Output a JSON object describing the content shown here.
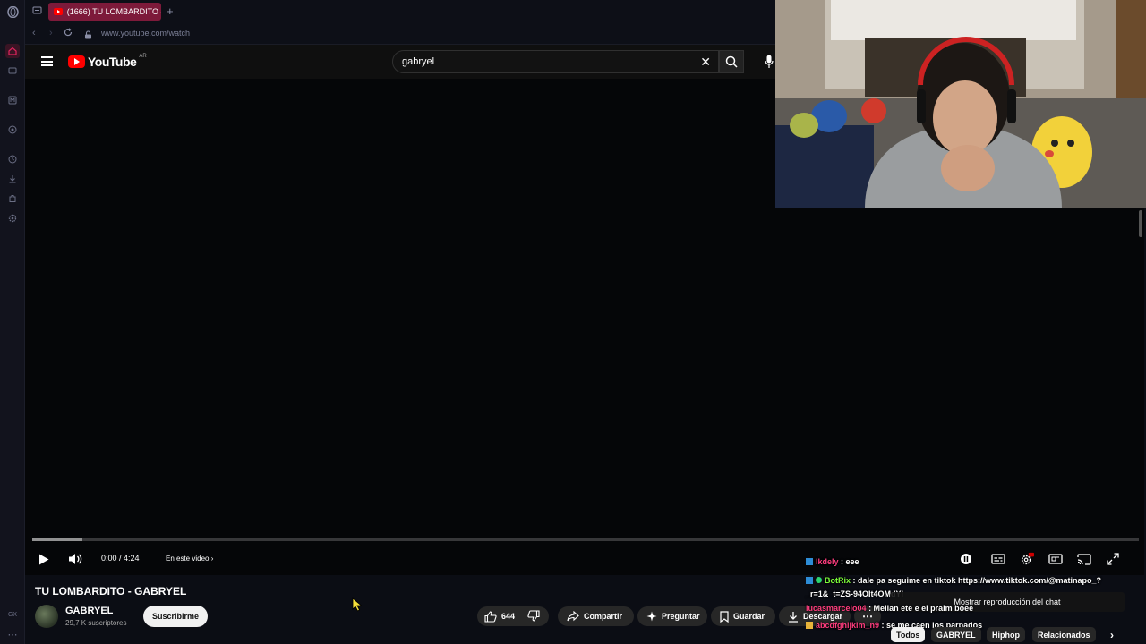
{
  "browser": {
    "tab_title": "(1666) TU LOMBARDITO -",
    "url": "www.youtube.com/watch",
    "sidebar_bottom_label": "GX"
  },
  "youtube": {
    "logo_text": "YouTube",
    "region": "AR",
    "search_value": "gabryel"
  },
  "player": {
    "time": "0:00 / 4:24",
    "chapter_label": "En este video",
    "buffered_fraction": 0.045
  },
  "video": {
    "title": "TU LOMBARDITO - GABRYEL",
    "channel": "GABRYEL",
    "subscribers": "29,7 K suscriptores",
    "subscribe_label": "Suscribirme",
    "likes": "644",
    "share_label": "Compartir",
    "ask_label": "Preguntar",
    "save_label": "Guardar",
    "download_label": "Descargar"
  },
  "chat": {
    "messages": [
      {
        "user": "lkdely",
        "text": ": eee"
      },
      {
        "user": "BotRix",
        "text": ": dale pa seguime en tiktok https://www.tiktok.com/@matinapo_?_r=1&_t=ZS-94OIt4OMdYI"
      },
      {
        "user": "lucasmarcelo04",
        "text": ": Melian ete e el praim boee"
      },
      {
        "user": "abcdfghijklm_n9",
        "text": ": se me caen los parpados"
      }
    ],
    "tooltip": "Mostrar reproducción del chat"
  },
  "chips": [
    "Todos",
    "GABRYEL",
    "Hiphop",
    "Relacionados"
  ],
  "colors": {
    "yt_red": "#ff0000",
    "tab_active": "#7d1a3a",
    "opera_accent": "#e0245e",
    "botrix_green": "#7dff3a",
    "user_pink": "#ff3d7f"
  }
}
